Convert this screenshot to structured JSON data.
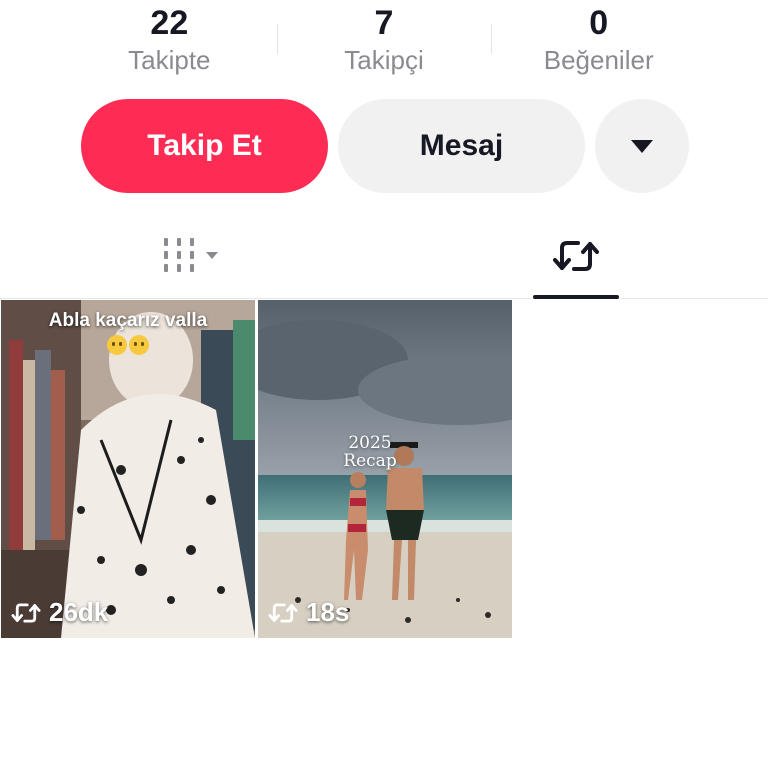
{
  "stats": [
    {
      "value": "22",
      "label": "Takipte"
    },
    {
      "value": "7",
      "label": "Takipçi"
    },
    {
      "value": "0",
      "label": "Beğeniler"
    }
  ],
  "actions": {
    "follow_label": "Takip Et",
    "message_label": "Mesaj",
    "more_icon": "caret-down-icon"
  },
  "tabs": [
    {
      "icon": "grid-columns-icon",
      "active": false
    },
    {
      "icon": "repost-icon",
      "active": true
    }
  ],
  "videos": [
    {
      "caption": "Abla kaçarız valla",
      "overlay": "",
      "time": "26dk",
      "icon": "repost-icon"
    },
    {
      "caption": "",
      "overlay": "2025\nRecap",
      "time": "18s",
      "icon": "repost-icon"
    }
  ],
  "colors": {
    "accent": "#fe2c55",
    "button_gray": "#f1f1f2",
    "text_dark": "#161823",
    "text_muted": "#8a8b91"
  }
}
